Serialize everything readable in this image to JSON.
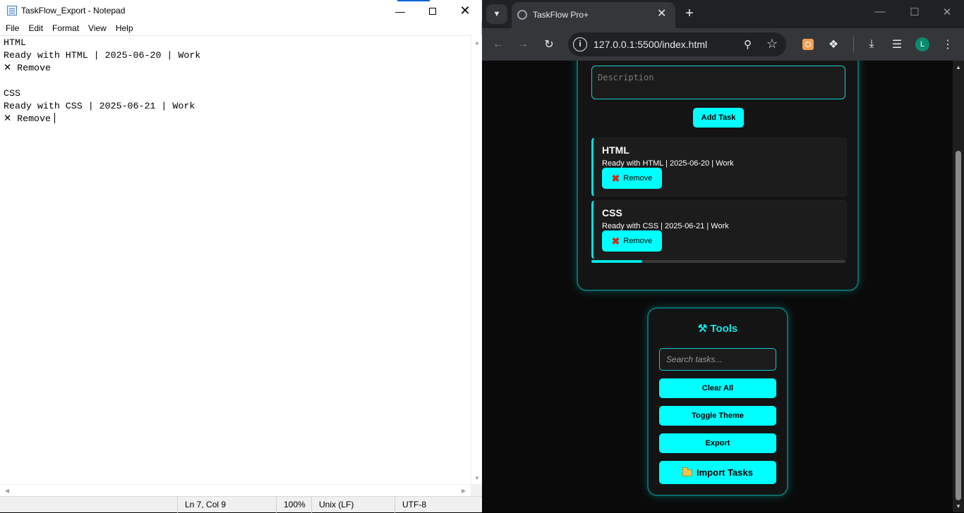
{
  "notepad": {
    "title": "TaskFlow_Export - Notepad",
    "menu": [
      "File",
      "Edit",
      "Format",
      "View",
      "Help"
    ],
    "lines": [
      "HTML",
      "Ready with HTML | 2025-06-20 | Work",
      "✕ Remove",
      "",
      "CSS",
      "Ready with CSS | 2025-06-21 | Work",
      "✕ Remove"
    ],
    "status": {
      "position": "Ln 7, Col 9",
      "zoom": "100%",
      "line_endings": "Unix (LF)",
      "encoding": "UTF-8"
    }
  },
  "browser": {
    "tab_title": "TaskFlow Pro+",
    "url": "127.0.0.1:5500/index.html",
    "avatar_letter": "L"
  },
  "app": {
    "description_placeholder": "Description",
    "add_task_label": "Add Task",
    "tasks": [
      {
        "title": "HTML",
        "meta": "Ready with HTML | 2025-06-20 | Work",
        "remove_label": "Remove"
      },
      {
        "title": "CSS",
        "meta": "Ready with CSS | 2025-06-21 | Work",
        "remove_label": "Remove"
      }
    ],
    "progress": 0.2,
    "tools": {
      "heading": "Tools",
      "search_placeholder": "Search tasks...",
      "clear_label": "Clear All",
      "toggle_theme_label": "Toggle Theme",
      "export_label": "Export",
      "import_label": "Import Tasks"
    },
    "accent_color": "#00ffff"
  }
}
